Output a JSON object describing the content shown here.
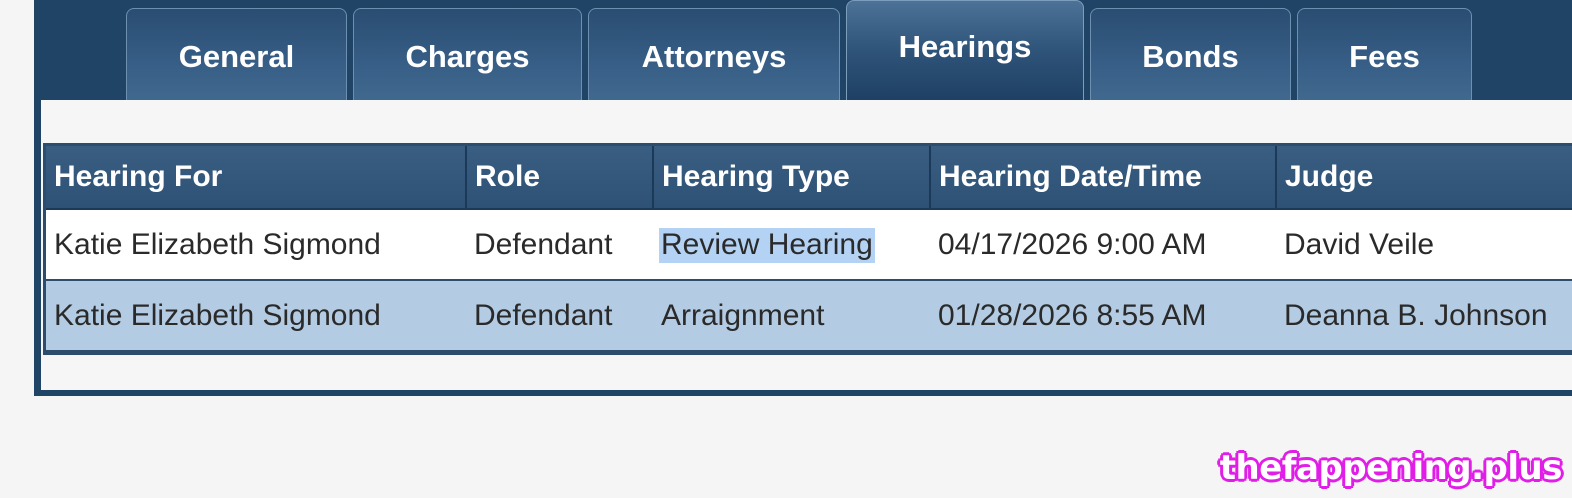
{
  "tabs": [
    {
      "label": "General",
      "active": false
    },
    {
      "label": "Charges",
      "active": false
    },
    {
      "label": "Attorneys",
      "active": false
    },
    {
      "label": "Hearings",
      "active": true
    },
    {
      "label": "Bonds",
      "active": false
    },
    {
      "label": "Fees",
      "active": false
    }
  ],
  "table": {
    "columns": [
      "Hearing For",
      "Role",
      "Hearing Type",
      "Hearing Date/Time",
      "Judge"
    ],
    "rows": [
      {
        "hearing_for": "Katie Elizabeth Sigmond",
        "role": "Defendant",
        "hearing_type": "Review Hearing",
        "datetime": "04/17/2026 9:00 AM",
        "judge": "David Veile"
      },
      {
        "hearing_for": "Katie Elizabeth Sigmond",
        "role": "Defendant",
        "hearing_type": "Arraignment",
        "datetime": "01/28/2026 8:55 AM",
        "judge": "Deanna B. Johnson"
      }
    ],
    "selected_text": "Review Hearing"
  },
  "watermark": "thefappening.plus",
  "colors": {
    "header_bg": "#2e5176",
    "tab_bar_bg": "#1f4466",
    "row_alt_bg": "#b3cbe3",
    "selection_bg": "#b4d2f4",
    "watermark": "#e01ee8"
  }
}
